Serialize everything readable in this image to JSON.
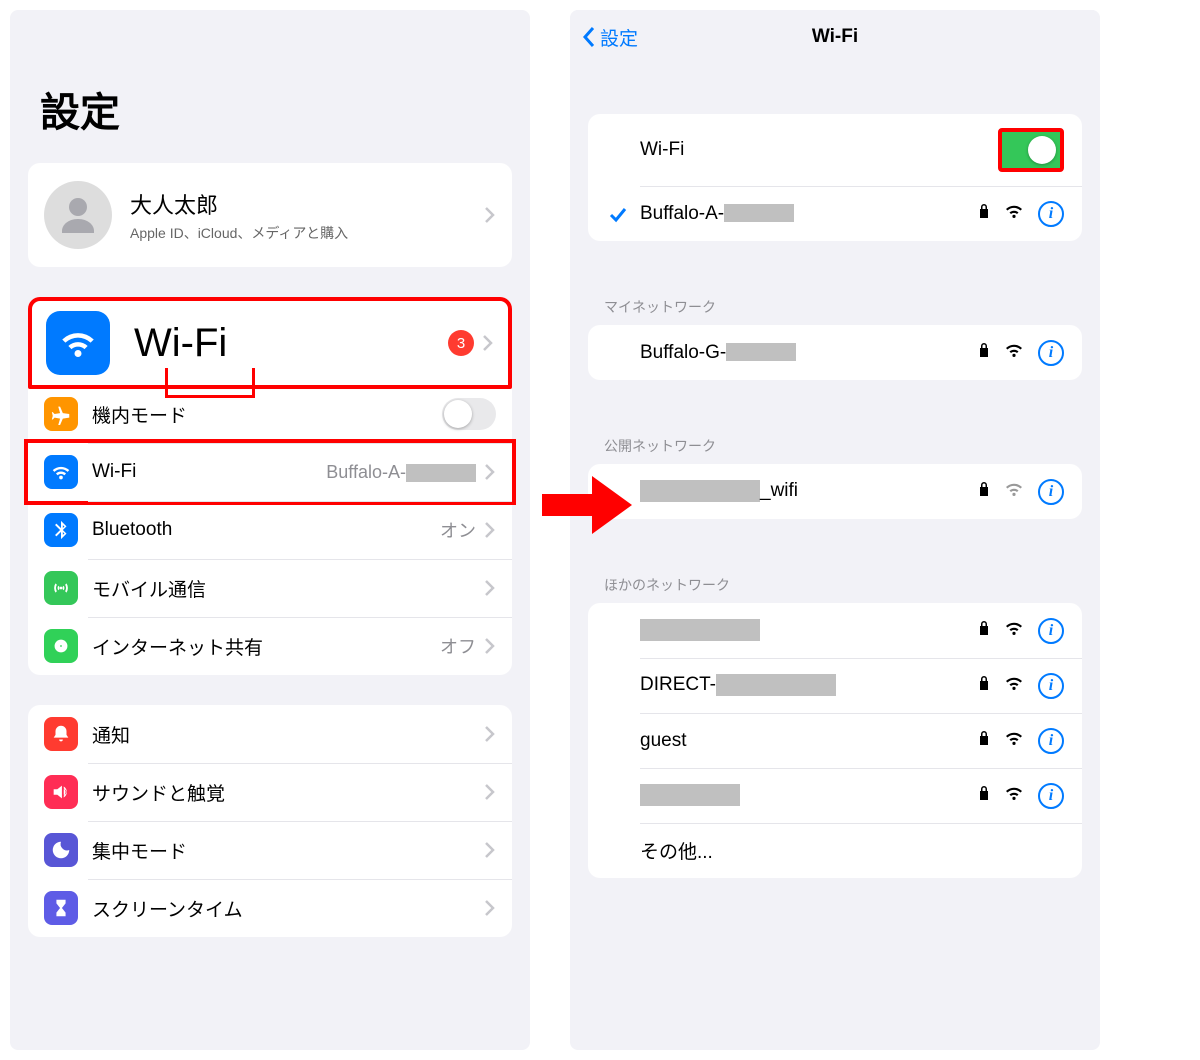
{
  "left": {
    "title": "設定",
    "profile": {
      "name": "大人太郎",
      "subtitle": "Apple ID、iCloud、メディアと購入"
    },
    "wifi_highlight": {
      "label": "Wi-Fi",
      "badge": "3"
    },
    "connectivity": {
      "airplane": "機内モード",
      "wifi": {
        "label": "Wi-Fi",
        "value": "Buffalo-A-"
      },
      "bluetooth": {
        "label": "Bluetooth",
        "value": "オン"
      },
      "cellular": "モバイル通信",
      "hotspot": {
        "label": "インターネット共有",
        "value": "オフ"
      }
    },
    "general": {
      "notifications": "通知",
      "sound": "サウンドと触覚",
      "focus": "集中モード",
      "screentime": "スクリーンタイム"
    }
  },
  "right": {
    "back": "設定",
    "title": "Wi-Fi",
    "toggle_label": "Wi-Fi",
    "connected": "Buffalo-A-",
    "sections": {
      "my": "マイネットワーク",
      "public": "公開ネットワーク",
      "other": "ほかのネットワーク"
    },
    "my_networks": [
      "Buffalo-G-"
    ],
    "public_networks": [
      "_wifi"
    ],
    "other_networks": [
      "",
      "DIRECT-",
      "guest",
      ""
    ],
    "other_label": "その他..."
  }
}
